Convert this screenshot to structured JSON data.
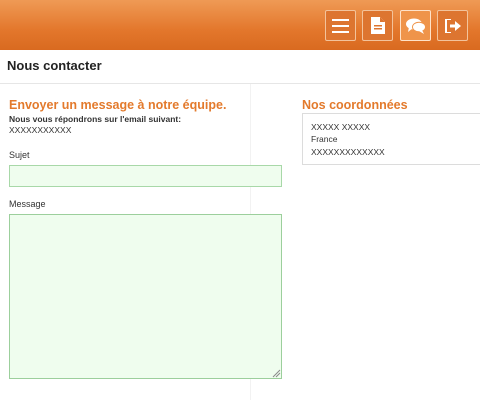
{
  "toolbar": {
    "buttons": [
      {
        "icon": "menu-icon",
        "label": "Menu"
      },
      {
        "icon": "document-icon",
        "label": "Documents"
      },
      {
        "icon": "chat-icon",
        "label": "Contact"
      },
      {
        "icon": "logout-icon",
        "label": "Logout"
      }
    ],
    "active_index": 2,
    "accent_color": "#e37a2c"
  },
  "page": {
    "title": "Nous contacter"
  },
  "form": {
    "heading": "Envoyer un message à notre équipe.",
    "reply_note": "Nous vous répondrons sur l'email suivant:",
    "reply_email": "XXXXXXXXXXX",
    "subject_label": "Sujet",
    "subject_value": "",
    "message_label": "Message",
    "message_value": ""
  },
  "coordinates": {
    "heading": "Nos coordonnées",
    "lines": [
      "XXXXX XXXXX",
      "France",
      "XXXXXXXXXXXXX"
    ]
  }
}
